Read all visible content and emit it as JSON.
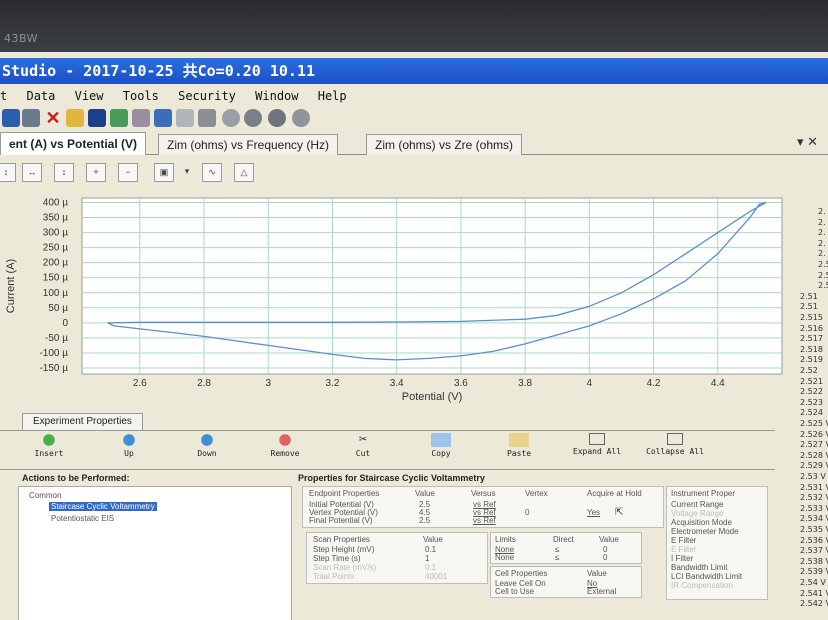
{
  "bezel_text": "43BW",
  "window_title": "Studio  -  2017-10-25 共Co=0.20 10.11",
  "menu": [
    "t",
    "Data",
    "View",
    "Tools",
    "Security",
    "Window",
    "Help"
  ],
  "tabs": [
    {
      "label": "ent (A) vs Potential (V)",
      "active": true
    },
    {
      "label": "Zim (ohms) vs Frequency (Hz)",
      "active": false
    },
    {
      "label": "Zim (ohms) vs Zre (ohms)",
      "active": false
    }
  ],
  "tab_controls": {
    "pin": "▾",
    "close": "✕"
  },
  "chart_data": {
    "type": "line",
    "xlabel": "Potential (V)",
    "ylabel": "Current (A)",
    "xlim": [
      2.42,
      4.6
    ],
    "ylim": [
      -170,
      415
    ],
    "x_ticks": [
      "2.6",
      "2.8",
      "3",
      "3.2",
      "3.4",
      "3.6",
      "3.8",
      "4",
      "4.2",
      "4.4"
    ],
    "x_tick_values": [
      2.6,
      2.8,
      3.0,
      3.2,
      3.4,
      3.6,
      3.8,
      4.0,
      4.2,
      4.4
    ],
    "y_ticks": [
      "400 µ",
      "350 µ",
      "300 µ",
      "250 µ",
      "200 µ",
      "150 µ",
      "100 µ",
      "50 µ",
      "0",
      "-50 µ",
      "-100 µ",
      "-150 µ"
    ],
    "y_tick_values": [
      400,
      350,
      300,
      250,
      200,
      150,
      100,
      50,
      0,
      -50,
      -100,
      -150
    ],
    "grid": true,
    "series": [
      {
        "color": "#5b8fc9",
        "x": [
          2.5,
          2.6,
          2.8,
          3.0,
          3.2,
          3.4,
          3.6,
          3.8,
          3.9,
          4.0,
          4.1,
          4.2,
          4.3,
          4.4,
          4.5,
          4.55,
          4.53,
          4.5,
          4.4,
          4.3,
          4.2,
          4.1,
          4.0,
          3.9,
          3.8,
          3.7,
          3.6,
          3.5,
          3.4,
          3.3,
          3.2,
          3.1,
          3.0,
          2.9,
          2.8,
          2.7,
          2.6,
          2.52,
          2.5
        ],
        "y": [
          0,
          2,
          2,
          2,
          2,
          3,
          5,
          12,
          25,
          55,
          100,
          160,
          230,
          300,
          370,
          400,
          395,
          350,
          230,
          140,
          80,
          30,
          -10,
          -40,
          -70,
          -95,
          -110,
          -118,
          -123,
          -118,
          -105,
          -90,
          -75,
          -60,
          -45,
          -32,
          -20,
          -10,
          0
        ]
      }
    ]
  },
  "chart_toolbar": [
    "zoom-fit",
    "zoom-x",
    "zoom-y",
    "zoom-in",
    "zoom-out",
    "copy-chart",
    "dropdown",
    "line-style",
    "peak"
  ],
  "right_column": [
    "2.",
    "2.",
    "2.",
    "2.",
    "2.",
    "2.5",
    "2.5",
    "2.5",
    "2.51",
    "2.51",
    "2.515",
    "2.516",
    "2.517",
    "2.518",
    "2.519",
    "2.52",
    "2.521",
    "2.522",
    "2.523",
    "2.524",
    "2.525 V",
    "2.526 V",
    "2.527 V",
    "2.528 V",
    "2.529 V",
    "2.53 V",
    "2.531 V",
    "2.532 V",
    "2.533 V",
    "2.534 V",
    "2.535 V",
    "2.536 V",
    "2.537 V",
    "2.538 V",
    "2.539 V",
    "2.54 V",
    "2.541 V",
    "2.542 V"
  ],
  "experiment_properties_tab": "Experiment Properties",
  "actions": [
    "Insert",
    "Up",
    "Down",
    "Remove",
    "Cut",
    "Copy",
    "Paste",
    "Expand All",
    "Collapse All"
  ],
  "actions_title": "Actions to be Performed:",
  "tree": {
    "root": "Common",
    "items": [
      "Staircase Cyclic Voltammetry",
      "Potentiostatic EIS"
    ],
    "selected": 0
  },
  "properties_title": "Properties for Staircase Cyclic Voltammetry",
  "endpoint": {
    "headers": [
      "Endpoint Properties",
      "Value",
      "Versus",
      "Vertex",
      "Acquire at Hold"
    ],
    "rows": [
      {
        "label": "Initial Potential (V)",
        "value": "2.5",
        "versus": "vs Ref",
        "vertex": "",
        "hold": ""
      },
      {
        "label": "Vertex Potential (V)",
        "value": "4.5",
        "versus": "vs Ref",
        "vertex": "0",
        "hold": "Yes"
      },
      {
        "label": "Final Potential (V)",
        "value": "2.5",
        "versus": "vs Ref",
        "vertex": "",
        "hold": ""
      }
    ]
  },
  "scan": {
    "headers": [
      "Scan Properties",
      "Value",
      "Limits",
      "Direct",
      "Value"
    ],
    "rows": [
      {
        "label": "Step Height (mV)",
        "value": "0.1",
        "limit": "None",
        "direct": "≤",
        "lvalue": "0"
      },
      {
        "label": "Step Time (s)",
        "value": "1",
        "limit": "None",
        "direct": "≤",
        "lvalue": "0"
      },
      {
        "label": "Scan Rate (mV/s)",
        "value": "0.1",
        "limit": "",
        "direct": "",
        "lvalue": ""
      },
      {
        "label": "Total Points",
        "value": "40001",
        "limit": "",
        "direct": "",
        "lvalue": ""
      }
    ]
  },
  "cell": {
    "headers": [
      "Cell Properties",
      "Value"
    ],
    "rows": [
      {
        "label": "Leave Cell On",
        "value": "No"
      },
      {
        "label": "Cell to Use",
        "value": "External"
      }
    ]
  },
  "instrument": {
    "header": "Instrument Proper",
    "rows": [
      "Current Range",
      "Voltage Range",
      "Acquisition Mode",
      "Electrometer Mode",
      "E Filter",
      "E Filter",
      "I Filter",
      "Bandwidth Limit",
      "LCI Bandwidth Limit",
      "IR Compensation"
    ]
  }
}
